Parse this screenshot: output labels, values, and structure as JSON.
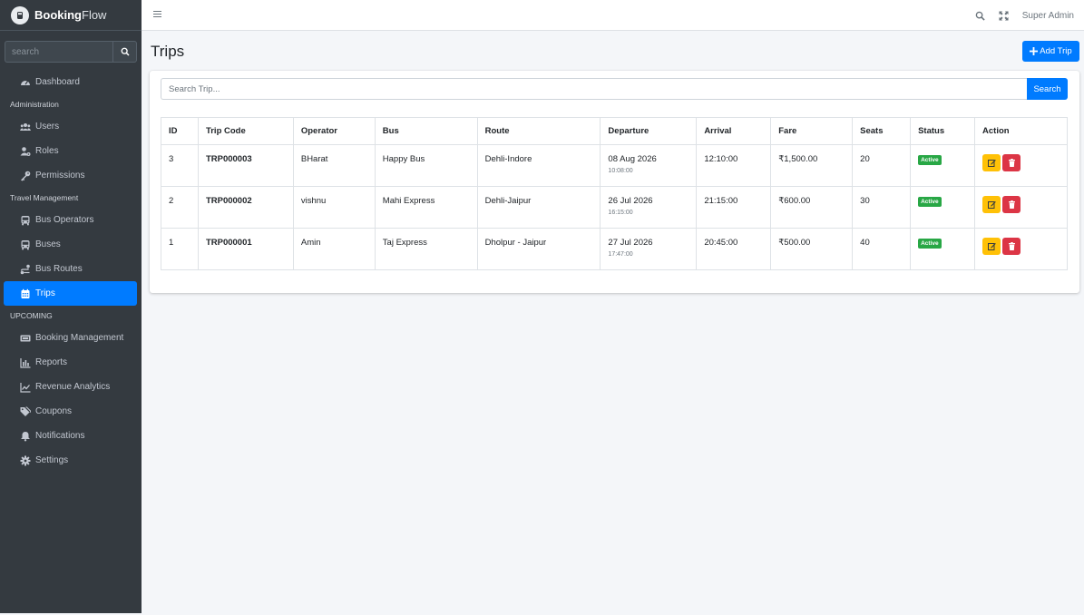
{
  "brand": {
    "name_bold": "Booking",
    "name_light": "Flow"
  },
  "sidebar": {
    "search_placeholder": "search",
    "items": [
      {
        "label": "Dashboard",
        "icon": "tachometer-icon"
      },
      {
        "header": "Administration"
      },
      {
        "label": "Users",
        "icon": "users-icon"
      },
      {
        "label": "Roles",
        "icon": "user-cog-icon"
      },
      {
        "label": "Permissions",
        "icon": "key-icon"
      },
      {
        "header": "Travel Management"
      },
      {
        "label": "Bus Operators",
        "icon": "bus-icon"
      },
      {
        "label": "Buses",
        "icon": "bus-icon"
      },
      {
        "label": "Bus Routes",
        "icon": "route-icon"
      },
      {
        "label": "Trips",
        "icon": "calendar-icon",
        "active": true
      },
      {
        "header": "UPCOMING"
      },
      {
        "label": "Booking Management",
        "icon": "ticket-icon"
      },
      {
        "label": "Reports",
        "icon": "chart-bar-icon"
      },
      {
        "label": "Revenue Analytics",
        "icon": "chart-line-icon"
      },
      {
        "label": "Coupons",
        "icon": "tags-icon"
      },
      {
        "label": "Notifications",
        "icon": "bell-icon"
      },
      {
        "label": "Settings",
        "icon": "cog-icon"
      }
    ]
  },
  "topbar": {
    "user": "Super Admin"
  },
  "page": {
    "title": "Trips",
    "add_button": "Add Trip"
  },
  "search": {
    "placeholder": "Search Trip...",
    "button": "Search"
  },
  "table": {
    "headers": [
      "ID",
      "Trip Code",
      "Operator",
      "Bus",
      "Route",
      "Departure",
      "Arrival",
      "Fare",
      "Seats",
      "Status",
      "Action"
    ],
    "rows": [
      {
        "id": "3",
        "code": "TRP000003",
        "operator": "BHarat",
        "bus": "Happy Bus",
        "route": "Dehli-Indore",
        "dep_date": "08 Aug 2026",
        "dep_time": "10:08:00",
        "arrival": "12:10:00",
        "fare": "₹1,500.00",
        "seats": "20",
        "status": "Active"
      },
      {
        "id": "2",
        "code": "TRP000002",
        "operator": "vishnu",
        "bus": "Mahi Express",
        "route": "Dehli-Jaipur",
        "dep_date": "26 Jul 2026",
        "dep_time": "16:15:00",
        "arrival": "21:15:00",
        "fare": "₹600.00",
        "seats": "30",
        "status": "Active"
      },
      {
        "id": "1",
        "code": "TRP000001",
        "operator": "Amin",
        "bus": "Taj Express",
        "route": "Dholpur - Jaipur",
        "dep_date": "27 Jul 2026",
        "dep_time": "17:47:00",
        "arrival": "20:45:00",
        "fare": "₹500.00",
        "seats": "40",
        "status": "Active"
      }
    ]
  },
  "colors": {
    "sidebar_bg": "#343a40",
    "primary": "#007bff",
    "success": "#28a745",
    "warning": "#ffc107",
    "danger": "#dc3545"
  }
}
